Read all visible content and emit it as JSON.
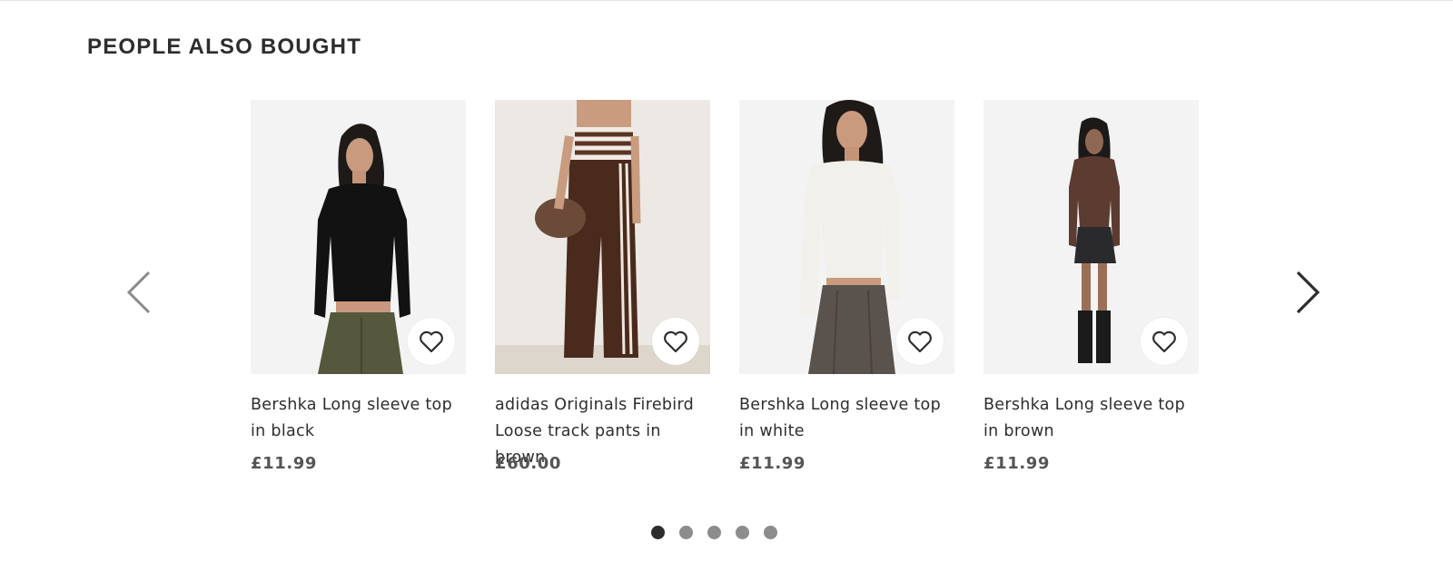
{
  "section": {
    "title": "PEOPLE ALSO BOUGHT"
  },
  "carousel": {
    "prev_icon": "chevron-left-icon",
    "next_icon": "chevron-right-icon",
    "products": [
      {
        "name": "Bershka Long sleeve top in black",
        "price": "£11.99",
        "wishlist_icon": "heart-icon"
      },
      {
        "name": "adidas Originals Firebird Loose track pants in brown",
        "price": "£60.00",
        "wishlist_icon": "heart-icon"
      },
      {
        "name": "Bershka Long sleeve top in white",
        "price": "£11.99",
        "wishlist_icon": "heart-icon"
      },
      {
        "name": "Bershka Long sleeve top in brown",
        "price": "£11.99",
        "wishlist_icon": "heart-icon"
      }
    ],
    "pagination": {
      "total_pages": 5,
      "current_page": 1
    }
  },
  "colors": {
    "text": "#2d2d2d",
    "price": "#555555",
    "image_bg": "#f3f3f3",
    "dot_active": "#2d2d2d",
    "dot_inactive": "#8c8c8c"
  }
}
